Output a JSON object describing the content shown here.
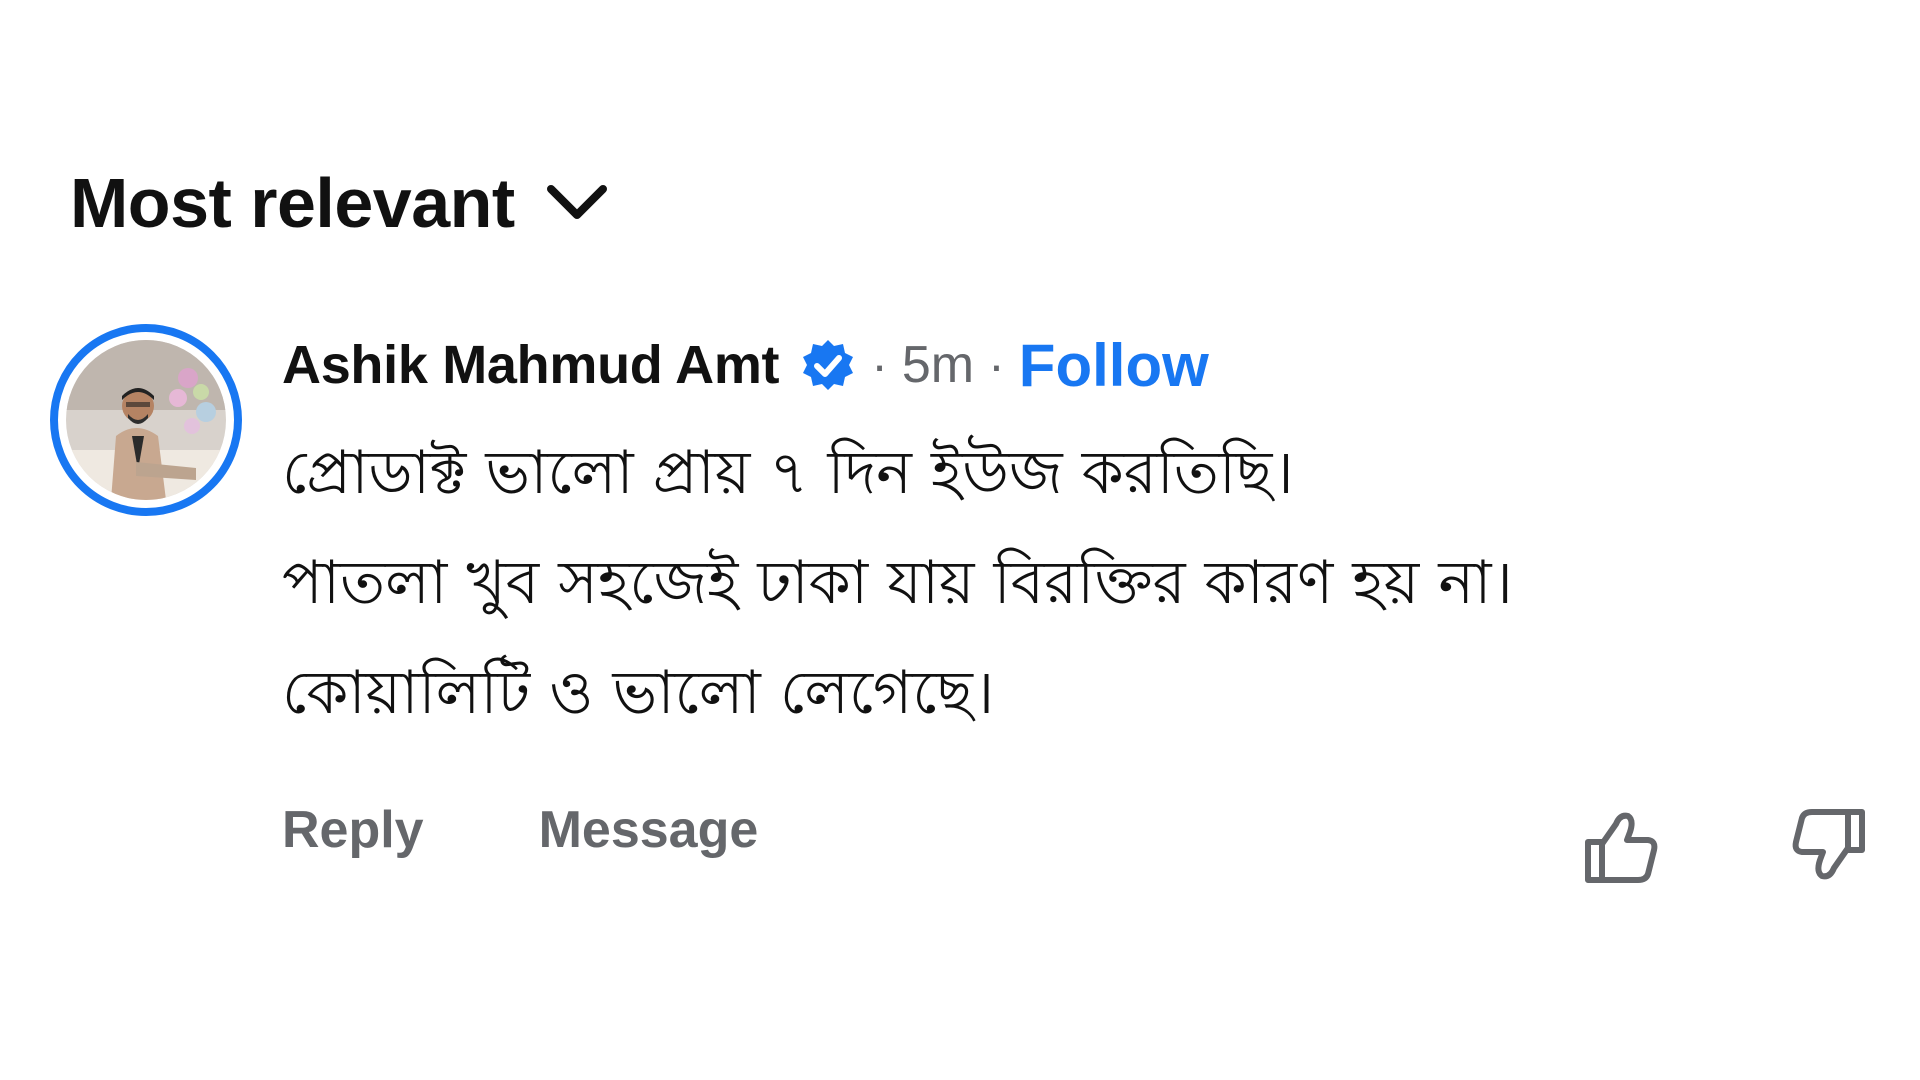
{
  "sort": {
    "label": "Most relevant",
    "icon": "chevron-down-icon"
  },
  "comment": {
    "author": "Ashik Mahmud Amt",
    "verified_icon": "verified-badge-icon",
    "separator": "·",
    "time": "5m",
    "follow_label": "Follow",
    "lines": [
      "প্রোডাক্ট ভালো প্রায় ৭ দিন ইউজ করতিছি।",
      "পাতলা খুব সহজেই ঢাকা যায় বিরক্তির কারণ হয় না।",
      "কোয়ালিটি ও ভালো লেগেছে।"
    ]
  },
  "actions": {
    "reply_label": "Reply",
    "message_label": "Message",
    "like_icon": "thumbs-up-icon",
    "dislike_icon": "thumbs-down-icon"
  },
  "colors": {
    "accent": "#1877f2",
    "secondary_text": "#65676b",
    "primary_text": "#111111"
  }
}
